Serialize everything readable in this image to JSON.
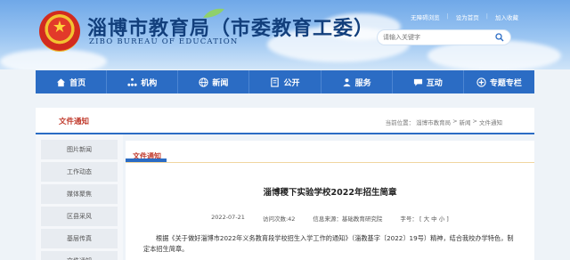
{
  "site": {
    "title": "淄博市教育局（市委教育工委）",
    "subtitle": "ZIBO BUREAU OF EDUCATION",
    "toplinks": [
      "无障碍浏览",
      "设为首页",
      "加入收藏"
    ]
  },
  "search": {
    "placeholder": "请输入关键字"
  },
  "nav": [
    {
      "label": "首页",
      "icon": "home-icon"
    },
    {
      "label": "机构",
      "icon": "org-icon"
    },
    {
      "label": "新闻",
      "icon": "globe-icon"
    },
    {
      "label": "公开",
      "icon": "doc-icon"
    },
    {
      "label": "服务",
      "icon": "people-icon"
    },
    {
      "label": "互动",
      "icon": "chat-icon"
    },
    {
      "label": "专题专栏",
      "icon": "plus-circle-icon"
    }
  ],
  "section": {
    "title": "文件通知",
    "location_label": "当前位置：",
    "breadcrumb": [
      "淄博市教育局",
      "新闻",
      "文件通知"
    ],
    "sep": ">"
  },
  "sidebar": {
    "items": [
      "图片新闻",
      "工作动态",
      "媒体聚焦",
      "区县采风",
      "基层传真",
      "文件通知"
    ]
  },
  "article": {
    "category": "文件通知",
    "title": "淄博稷下实验学校2022年招生简章",
    "date": "2022-07-21",
    "views": "访问次数:42",
    "source": "信息来源：基础教育研究院",
    "fontsize_label": "字号：",
    "fontsize_options": "[ 大 中 小 ]",
    "body": "根据《关于做好淄博市2022年义务教育段学校招生入学工作的通知》（淄教基字〔2022〕19号）精神，结合我校办学特色，制定本招生简章。"
  },
  "colors": {
    "nav": "#2b6cc4",
    "accent": "#c0392b",
    "title": "#123f7c"
  }
}
